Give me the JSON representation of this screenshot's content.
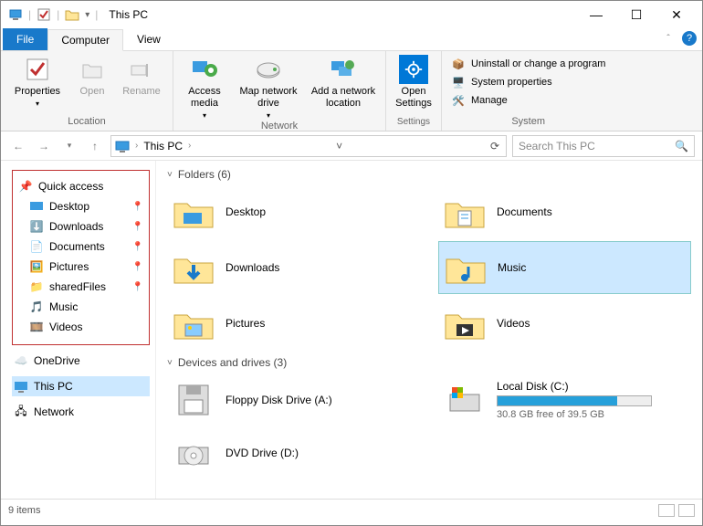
{
  "window": {
    "title": "This PC"
  },
  "tabs": {
    "file": "File",
    "computer": "Computer",
    "view": "View"
  },
  "ribbon": {
    "location": {
      "label": "Location",
      "properties": "Properties",
      "open": "Open",
      "rename": "Rename"
    },
    "network": {
      "label": "Network",
      "access_media": "Access media",
      "map_drive": "Map network drive",
      "add_loc": "Add a network location"
    },
    "settings": {
      "label": "Settings",
      "open_settings": "Open Settings"
    },
    "system": {
      "label": "System",
      "uninstall": "Uninstall or change a program",
      "props": "System properties",
      "manage": "Manage"
    }
  },
  "address": {
    "crumb": "This PC"
  },
  "search": {
    "placeholder": "Search This PC"
  },
  "sidebar": {
    "quick": "Quick access",
    "items": [
      {
        "label": "Desktop",
        "pinned": true
      },
      {
        "label": "Downloads",
        "pinned": true
      },
      {
        "label": "Documents",
        "pinned": true
      },
      {
        "label": "Pictures",
        "pinned": true
      },
      {
        "label": "sharedFiles",
        "pinned": true
      },
      {
        "label": "Music",
        "pinned": false
      },
      {
        "label": "Videos",
        "pinned": false
      }
    ],
    "onedrive": "OneDrive",
    "thispc": "This PC",
    "network": "Network"
  },
  "sections": {
    "folders": {
      "header": "Folders (6)",
      "items": [
        "Desktop",
        "Documents",
        "Downloads",
        "Music",
        "Pictures",
        "Videos"
      ]
    },
    "drives": {
      "header": "Devices and drives (3)",
      "floppy": "Floppy Disk Drive (A:)",
      "local": {
        "name": "Local Disk (C:)",
        "free": "30.8 GB free of 39.5 GB",
        "pct": 78
      },
      "dvd": "DVD Drive (D:)"
    }
  },
  "status": {
    "items": "9 items"
  }
}
